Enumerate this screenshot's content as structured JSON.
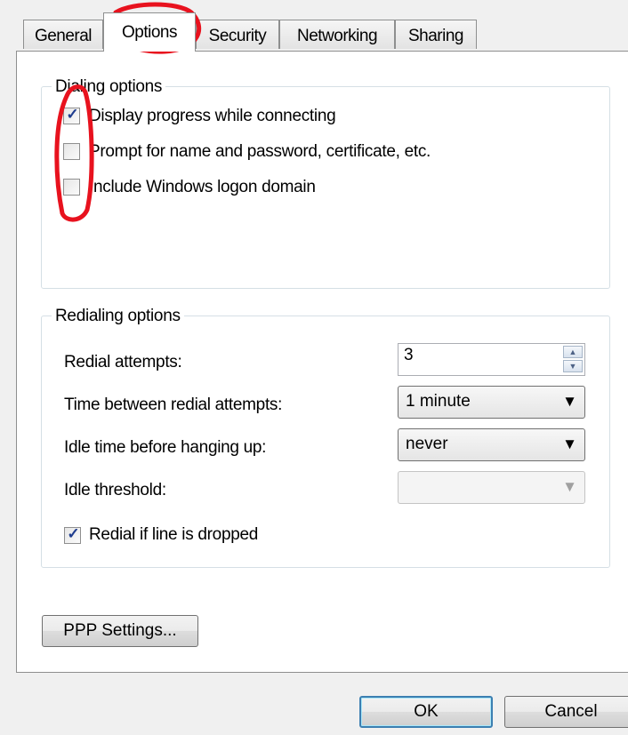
{
  "tabs": [
    {
      "label": "General"
    },
    {
      "label": "Options",
      "active": true
    },
    {
      "label": "Security"
    },
    {
      "label": "Networking"
    },
    {
      "label": "Sharing"
    }
  ],
  "dialing": {
    "title": "Dialing options",
    "items": [
      {
        "label": "Display progress while connecting",
        "checked": true
      },
      {
        "label": "Prompt for name and password, certificate, etc.",
        "checked": false
      },
      {
        "label": "Include Windows logon domain",
        "checked": false
      }
    ]
  },
  "redialing": {
    "title": "Redialing options",
    "attempts_label": "Redial attempts:",
    "attempts_value": "3",
    "time_label": "Time between redial attempts:",
    "time_value": "1 minute",
    "idle_label": "Idle time before hanging up:",
    "idle_value": "never",
    "threshold_label": "Idle threshold:",
    "threshold_value": "",
    "redial_dropped_label": "Redial if line is dropped",
    "redial_dropped_checked": true
  },
  "ppp_button": "PPP Settings...",
  "ok_button": "OK",
  "cancel_button": "Cancel",
  "colors": {
    "annotation": "#e8121e",
    "check": "#1f3d8f"
  }
}
